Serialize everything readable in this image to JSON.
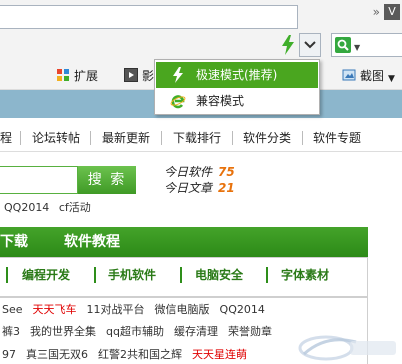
{
  "browser": {
    "overflow_chevron": "»",
    "window_button": "V",
    "address_value": "",
    "search_value": "",
    "toolbar": [
      {
        "name": "extensions",
        "label": "扩展"
      },
      {
        "name": "video",
        "label": "影"
      },
      {
        "name": "screenshot",
        "label": "截图"
      }
    ]
  },
  "mode_menu": {
    "items": [
      {
        "label": "极速模式(推荐)",
        "selected": true,
        "icon": "bolt-icon"
      },
      {
        "label": "兼容模式",
        "selected": false,
        "icon": "ie-icon"
      }
    ]
  },
  "page": {
    "nav": [
      "程",
      "论坛转帖",
      "最新更新",
      "下载排行",
      "软件分类",
      "软件专题"
    ],
    "search_button": "搜 索",
    "stats": [
      {
        "label": "今日软件",
        "value": "75"
      },
      {
        "label": "今日文章",
        "value": "21"
      }
    ],
    "hot_keywords": [
      "QQ2014",
      "cf活动"
    ],
    "green_tabs": [
      "下载",
      "软件教程"
    ],
    "categories": [
      "编程开发",
      "手机软件",
      "电脑安全",
      "字体素材"
    ],
    "list_rows": [
      [
        {
          "text": "See",
          "red": false
        },
        {
          "text": "天天飞车",
          "red": true
        },
        {
          "text": "11对战平台",
          "red": false
        },
        {
          "text": "微信电脑版",
          "red": false
        },
        {
          "text": "QQ2014",
          "red": false
        }
      ],
      [
        {
          "text": "裤3",
          "red": false
        },
        {
          "text": "我的世界全集",
          "red": false
        },
        {
          "text": "qq超市辅助",
          "red": false
        },
        {
          "text": "缓存清理",
          "red": false
        },
        {
          "text": "荣誉勋章",
          "red": false
        }
      ],
      [
        {
          "text": "97",
          "red": false
        },
        {
          "text": "真三国无双6",
          "red": false
        },
        {
          "text": "红警2共和国之辉",
          "red": false
        },
        {
          "text": "天天星连萌",
          "red": true
        }
      ]
    ]
  },
  "colors": {
    "menu_selected": "#4aa61f",
    "green_bar": "#3a9a22",
    "stat_value": "#e8720c",
    "highlight_red": "#e00000"
  }
}
